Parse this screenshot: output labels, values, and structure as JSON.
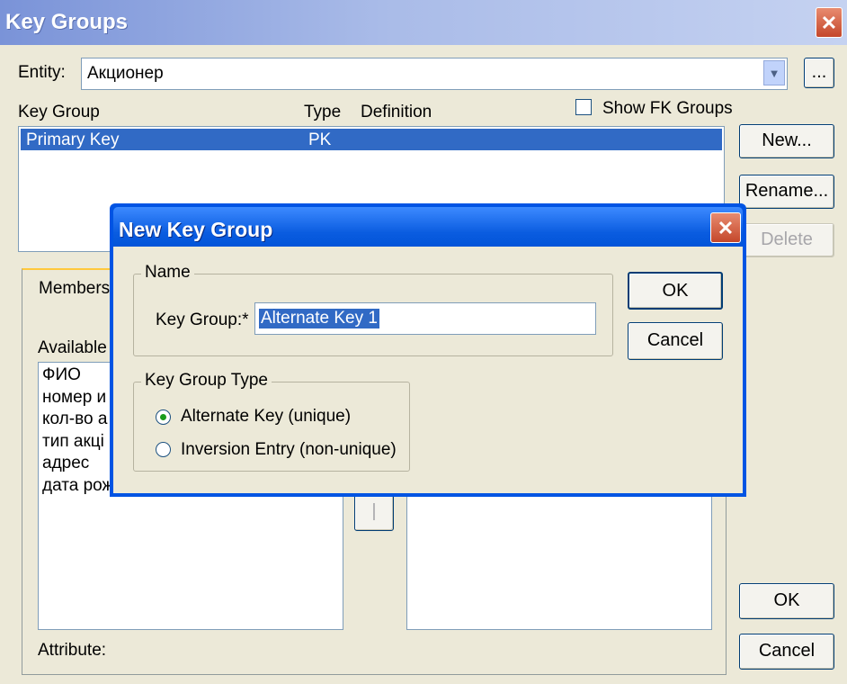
{
  "main_window": {
    "title": "Key Groups",
    "close_glyph": "✕",
    "entity_label": "Entity:",
    "entity_value": "Акционер",
    "browse_label": "...",
    "columns": [
      "Key Group",
      "Type",
      "Definition"
    ],
    "show_fk_label": "Show FK Groups",
    "rows": [
      {
        "key_group": "Primary Key",
        "type": "PK",
        "definition": ""
      }
    ],
    "buttons": {
      "new": "New...",
      "rename": "Rename...",
      "delete": "Delete",
      "ok": "OK",
      "cancel": "Cancel"
    },
    "tab_members": "Members",
    "available_label": "Available",
    "available_items": [
      "ФИО",
      "номер и",
      "кол-во а",
      "тип акці",
      "адрес",
      "дата рож"
    ],
    "attribute_label": "Attribute:"
  },
  "dialog": {
    "title": "New Key Group",
    "close_glyph": "✕",
    "name_group": "Name",
    "key_group_label": "Key Group:*",
    "key_group_value": "Alternate Key 1",
    "type_group": "Key Group Type",
    "options": [
      "Alternate Key (unique)",
      "Inversion Entry (non-unique)"
    ],
    "selected_option": 0,
    "ok": "OK",
    "cancel": "Cancel"
  },
  "colors": {
    "selection": "#316ac5",
    "dialog_border": "#0054e3"
  }
}
